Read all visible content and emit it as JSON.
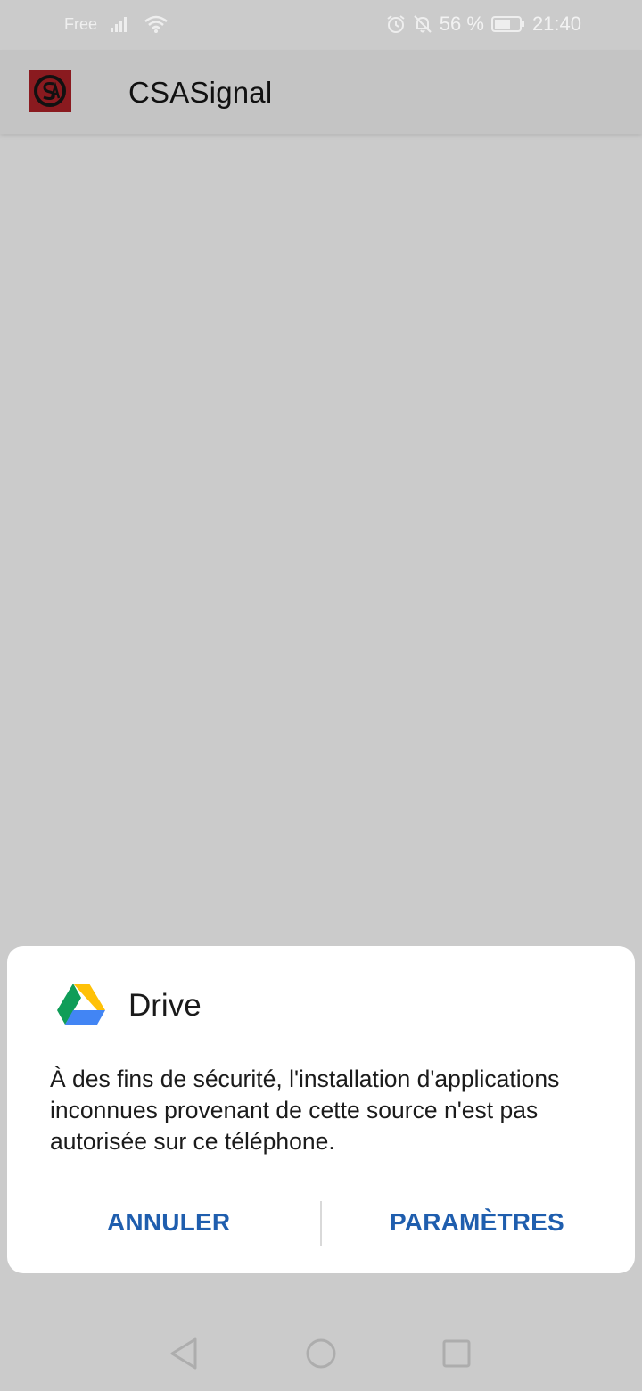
{
  "status_bar": {
    "carrier": "Free",
    "battery": "56 %",
    "time": "21:40",
    "icons": [
      "signal-icon",
      "wifi-icon",
      "alarm-icon",
      "notifications-off-icon",
      "battery-icon"
    ]
  },
  "app_bar": {
    "title": "CSASignal",
    "logo_icon": "csa-logo-icon"
  },
  "dialog": {
    "app_name": "Drive",
    "app_icon": "google-drive-icon",
    "message": "À des fins de sécurité, l'installation d'applications inconnues provenant de cette source n'est pas autorisée sur ce téléphone.",
    "cancel_label": "ANNULER",
    "settings_label": "PARAMÈTRES",
    "accent_color": "#1f5eae"
  },
  "nav_bar": {
    "icons": [
      "back-icon",
      "home-icon",
      "recents-icon"
    ]
  },
  "colors": {
    "scrim": "#cbcbcb",
    "app_bar": "#c4c4c4",
    "logo_background": "#8a1a1f"
  }
}
